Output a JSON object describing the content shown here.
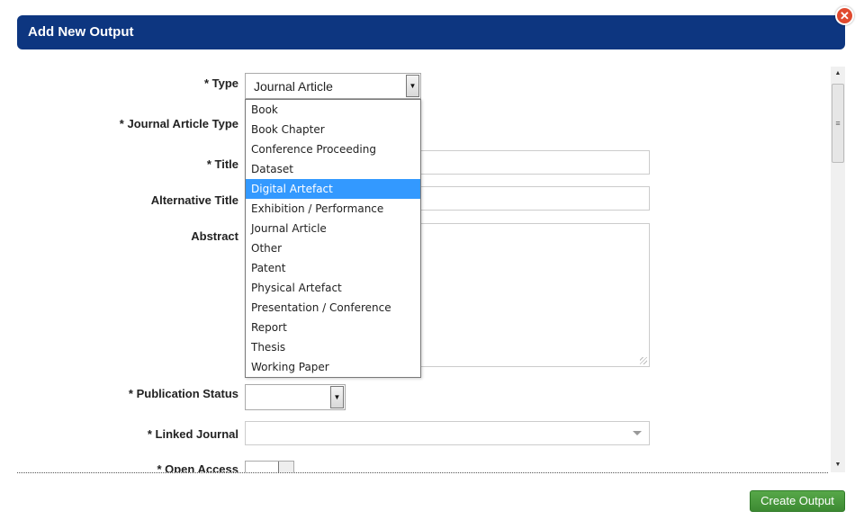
{
  "dialog": {
    "title": "Add New Output",
    "close_icon": "close-icon",
    "create_button_label": "Create Output"
  },
  "form": {
    "type": {
      "label": "* Type",
      "value": "Journal Article"
    },
    "journal_article_type": {
      "label": "* Journal Article Type"
    },
    "title": {
      "label": "* Title",
      "value": ""
    },
    "alternative_title": {
      "label": "Alternative Title",
      "value": ""
    },
    "abstract": {
      "label": "Abstract",
      "value": ""
    },
    "publication_status": {
      "label": "* Publication Status",
      "value": ""
    },
    "linked_journal": {
      "label": "* Linked Journal",
      "value": ""
    },
    "open_access": {
      "label": "* Open Access"
    }
  },
  "dropdown": {
    "options": [
      "Book",
      "Book Chapter",
      "Conference Proceeding",
      "Dataset",
      "Digital Artefact",
      "Exhibition / Performance",
      "Journal Article",
      "Other",
      "Patent",
      "Physical Artefact",
      "Presentation / Conference",
      "Report",
      "Thesis",
      "Working Paper"
    ],
    "highlighted": "Digital Artefact"
  },
  "colors": {
    "header": "#0d3680",
    "highlight": "#3399ff",
    "create_button": "#4a9a3e",
    "close_button": "#e04a2f"
  }
}
